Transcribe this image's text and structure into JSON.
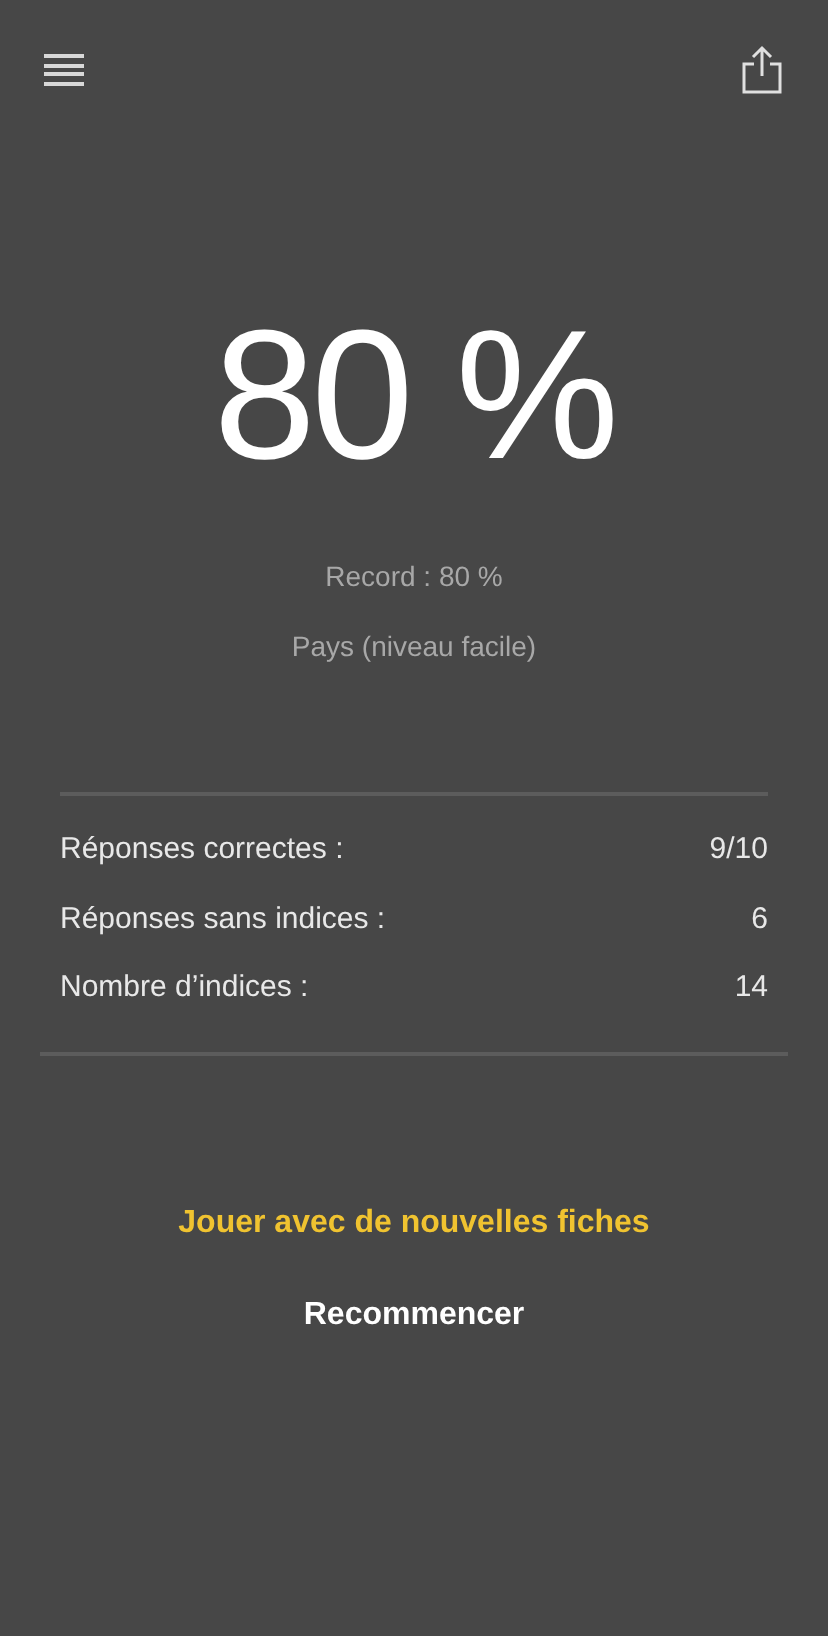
{
  "score": "80 %",
  "record": "Record : 80 %",
  "category": "Pays (niveau facile)",
  "stats": [
    {
      "label": "Réponses correctes :",
      "value": "9/10"
    },
    {
      "label": "Réponses sans indices :",
      "value": "6"
    },
    {
      "label": "Nombre d’indices :",
      "value": "14"
    }
  ],
  "actions": [
    {
      "label": "Jouer avec de nouvelles fiches",
      "kind": "primary"
    },
    {
      "label": "Recommencer",
      "kind": "secondary"
    }
  ]
}
